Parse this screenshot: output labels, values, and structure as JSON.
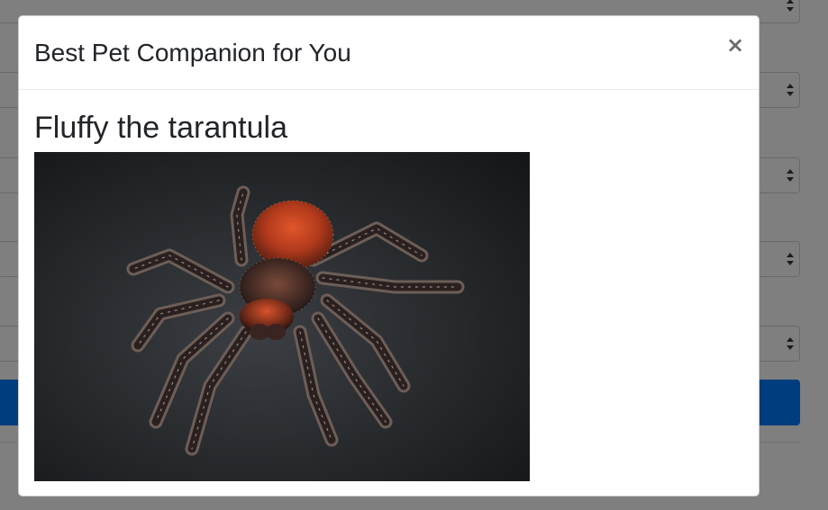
{
  "modal": {
    "title": "Best Pet Companion for You",
    "close_symbol": "×",
    "close_icon": "close-icon"
  },
  "pet": {
    "name": "Fluffy the tarantula",
    "image_subject": "tarantula",
    "image_alt": "Fluffy the tarantula"
  },
  "colors": {
    "primary": "#007bff",
    "text": "#212529",
    "backdrop": "rgba(0,0,0,0.5)"
  }
}
